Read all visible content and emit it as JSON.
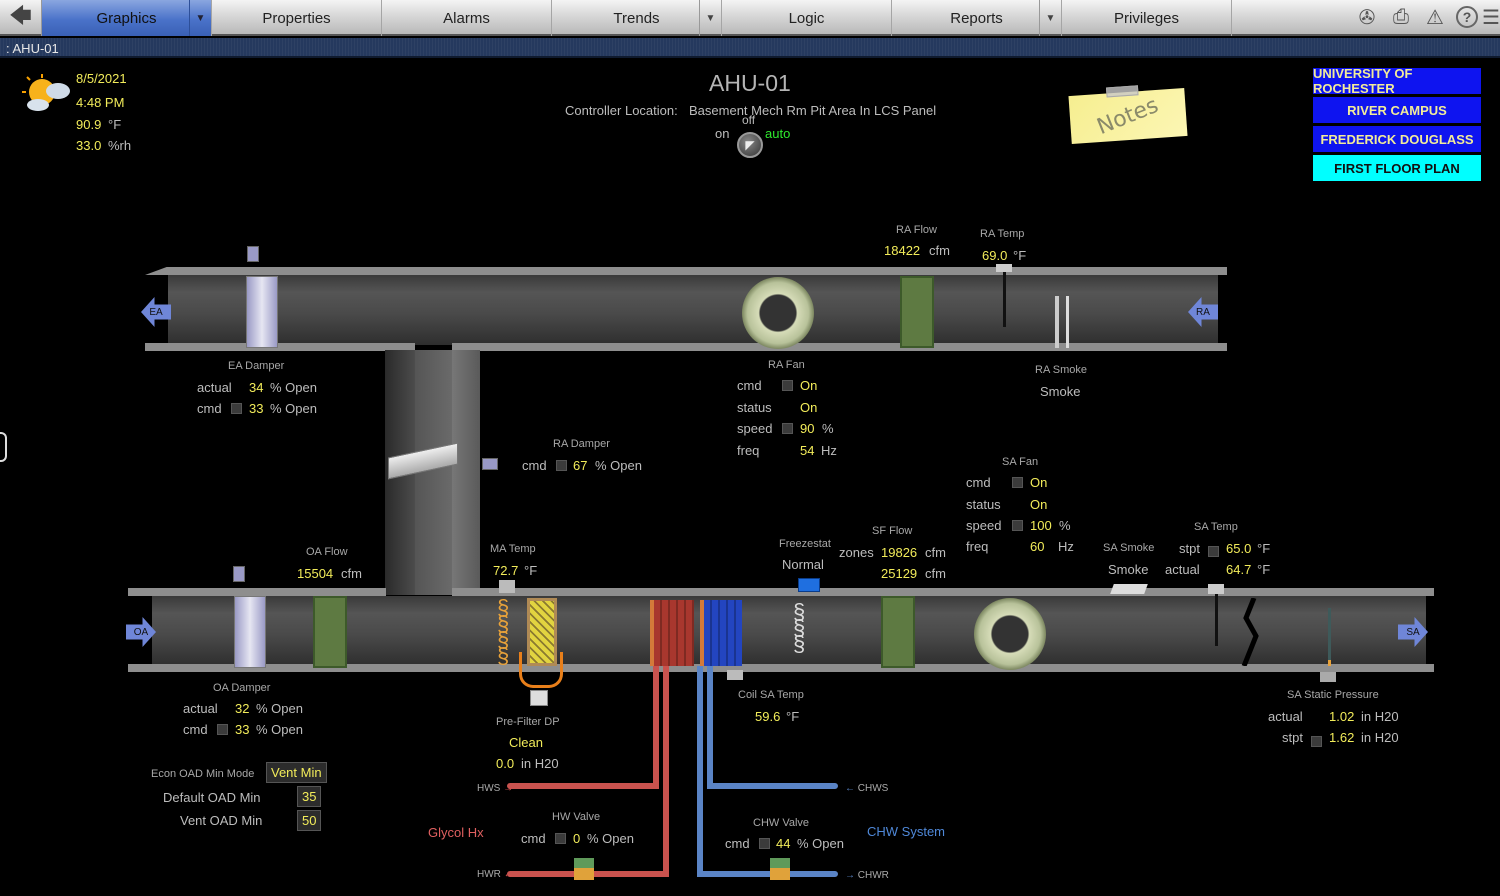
{
  "nav": {
    "back_icon": "back-arrow-icon",
    "tabs": [
      {
        "label": "Graphics",
        "active": true,
        "dropdown": true
      },
      {
        "label": "Properties",
        "active": false,
        "dropdown": false
      },
      {
        "label": "Alarms",
        "active": false,
        "dropdown": false
      },
      {
        "label": "Trends",
        "active": false,
        "dropdown": true
      },
      {
        "label": "Logic",
        "active": false,
        "dropdown": false
      },
      {
        "label": "Reports",
        "active": false,
        "dropdown": true
      },
      {
        "label": "Privileges",
        "active": false,
        "dropdown": false
      }
    ],
    "dropdown_glyph": "▼",
    "icons": [
      "film-reel-icon",
      "printer-icon",
      "alarm-warning-icon",
      "help-icon"
    ]
  },
  "breadcrumb": ": AHU-01",
  "weather": {
    "date": "8/5/2021",
    "time": "4:48 PM",
    "temp": "90.9",
    "temp_unit": "°F",
    "rh": "33.0",
    "rh_unit": "%rh"
  },
  "header": {
    "title": "AHU-01",
    "controller_label": "Controller Location:",
    "controller_location": "Basement Mech Rm Pit Area In LCS Panel",
    "switch": {
      "on": "on",
      "off": "off",
      "auto": "auto"
    }
  },
  "notes_label": "Notes",
  "location_buttons": [
    {
      "label": "UNIVERSITY OF ROCHESTER",
      "color": "#0e14f0"
    },
    {
      "label": "RIVER CAMPUS",
      "color": "#0e14f0"
    },
    {
      "label": "FREDERICK DOUGLASS",
      "color": "#0e14f0"
    },
    {
      "label": "FIRST FLOOR PLAN",
      "color": "#00ffff"
    }
  ],
  "duct_labels": {
    "ea": "EA",
    "ra": "RA",
    "oa": "OA",
    "sa": "SA"
  },
  "ra_flow": {
    "title": "RA Flow",
    "value": "18422",
    "unit": "cfm"
  },
  "ra_temp": {
    "title": "RA Temp",
    "value": "69.0",
    "unit": "°F"
  },
  "ra_smoke": {
    "title": "RA Smoke",
    "value": "Smoke"
  },
  "ea_damper": {
    "title": "EA Damper",
    "actual_label": "actual",
    "actual": "34",
    "actual_unit": "% Open",
    "cmd_label": "cmd",
    "cmd": "33",
    "cmd_unit": "% Open"
  },
  "ra_fan": {
    "title": "RA Fan",
    "cmd_label": "cmd",
    "cmd": "On",
    "status_label": "status",
    "status": "On",
    "speed_label": "speed",
    "speed": "90",
    "speed_unit": "%",
    "freq_label": "freq",
    "freq": "54",
    "freq_unit": "Hz"
  },
  "ra_damper": {
    "title": "RA Damper",
    "cmd_label": "cmd",
    "cmd": "67",
    "cmd_unit": "% Open"
  },
  "sa_fan": {
    "title": "SA Fan",
    "cmd_label": "cmd",
    "cmd": "On",
    "status_label": "status",
    "status": "On",
    "speed_label": "speed",
    "speed": "100",
    "speed_unit": "%",
    "freq_label": "freq",
    "freq": "60",
    "freq_unit": "Hz"
  },
  "oa_flow": {
    "title": "OA Flow",
    "value": "15504",
    "unit": "cfm"
  },
  "ma_temp": {
    "title": "MA Temp",
    "value": "72.7",
    "unit": "°F"
  },
  "freezestat": {
    "title": "Freezestat",
    "value": "Normal"
  },
  "sf_flow": {
    "title": "SF Flow",
    "zones_label": "zones",
    "zones": "19826",
    "total": "25129",
    "unit": "cfm"
  },
  "sa_smoke": {
    "title": "SA Smoke",
    "value": "Smoke"
  },
  "sa_temp": {
    "title": "SA Temp",
    "stpt_label": "stpt",
    "stpt": "65.0",
    "actual_label": "actual",
    "actual": "64.7",
    "unit": "°F"
  },
  "oa_damper": {
    "title": "OA Damper",
    "actual_label": "actual",
    "actual": "32",
    "actual_unit": "% Open",
    "cmd_label": "cmd",
    "cmd": "33",
    "cmd_unit": "% Open"
  },
  "econ": {
    "mode_label": "Econ OAD Min Mode",
    "mode": "Vent Min",
    "default_label": "Default OAD Min",
    "default": "35",
    "vent_label": "Vent OAD Min",
    "vent": "50"
  },
  "prefilter": {
    "title": "Pre-Filter DP",
    "status": "Clean",
    "value": "0.0",
    "unit": "in H20"
  },
  "coil_sa_temp": {
    "title": "Coil SA Temp",
    "value": "59.6",
    "unit": "°F"
  },
  "sa_static": {
    "title": "SA Static Pressure",
    "actual_label": "actual",
    "actual": "1.02",
    "stpt_label": "stpt",
    "stpt": "1.62",
    "unit": "in H20"
  },
  "hw": {
    "system": "Glycol Hx",
    "system_color": "#e06060",
    "supply": "HWS",
    "return": "HWR",
    "valve_title": "HW Valve",
    "cmd_label": "cmd",
    "cmd": "0",
    "cmd_unit": "% Open"
  },
  "chw": {
    "system": "CHW System",
    "system_color": "#4f88d8",
    "supply": "CHWS",
    "return": "CHWR",
    "valve_title": "CHW Valve",
    "cmd_label": "cmd",
    "cmd": "44",
    "cmd_unit": "% Open"
  }
}
